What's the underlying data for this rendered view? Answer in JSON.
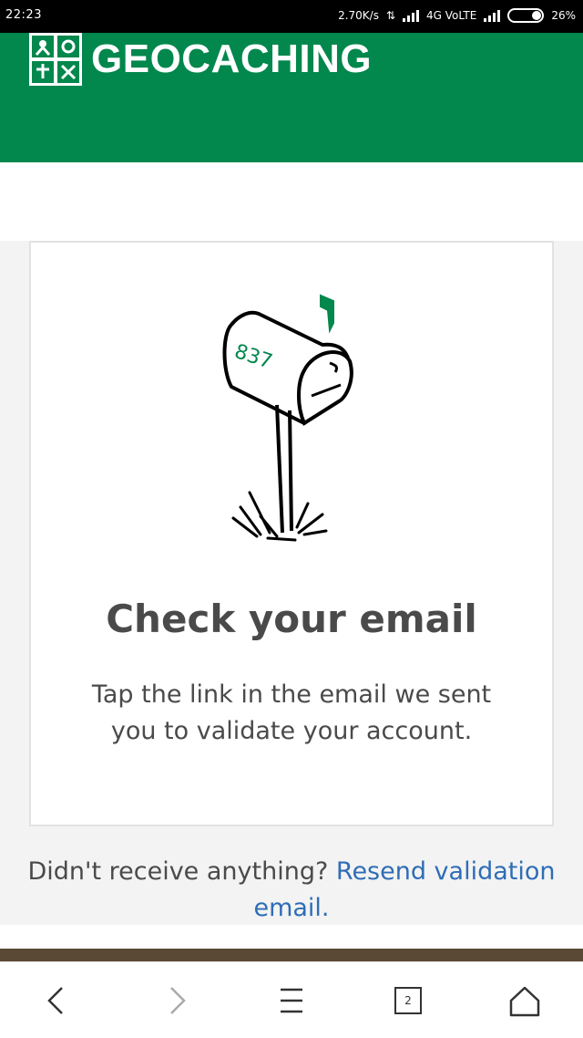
{
  "status_bar": {
    "time": "22:23",
    "speed": "2.70K/s",
    "network": "4G VoLTE",
    "battery": "26%"
  },
  "header": {
    "brand": "GEOCACHING",
    "brand_color": "#02874D"
  },
  "card": {
    "title": "Check your email",
    "body": "Tap the link in the email we sent you to validate your account.",
    "mailbox_number": "837"
  },
  "resend": {
    "prefix": "Didn't receive anything?",
    "link_label": "Resend validation email.",
    "link_color": "#2f6db5"
  },
  "browser_nav": {
    "back_icon": "chevron-left-icon",
    "forward_icon": "chevron-right-icon",
    "menu_icon": "menu-icon",
    "tab_count": "2",
    "home_icon": "home-icon"
  }
}
